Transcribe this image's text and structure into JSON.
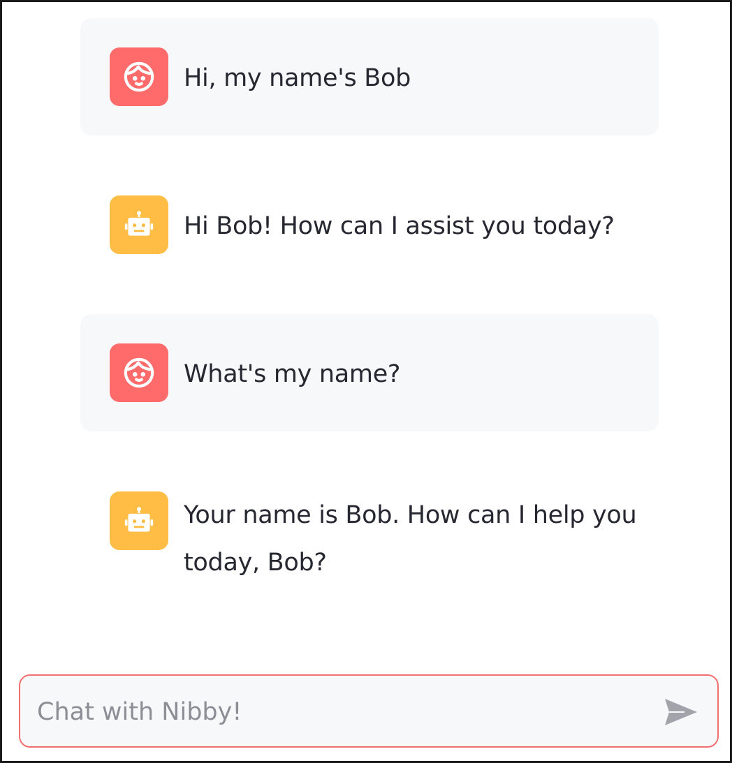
{
  "colors": {
    "user_avatar": "#ff6b6b",
    "assistant_avatar": "#ffbd45",
    "user_bubble": "#f7f8fa",
    "input_border": "#f36f6f",
    "text": "#262730"
  },
  "messages": [
    {
      "role": "user",
      "icon": "face-icon",
      "text": "Hi, my name's Bob"
    },
    {
      "role": "assistant",
      "icon": "robot-icon",
      "text": "Hi Bob! How can I assist you today?"
    },
    {
      "role": "user",
      "icon": "face-icon",
      "text": "What's my name?"
    },
    {
      "role": "assistant",
      "icon": "robot-icon",
      "text": "Your name is Bob. How can I help you today, Bob?"
    }
  ],
  "chat_input": {
    "placeholder": "Chat with Nibby!",
    "value": "",
    "send_icon": "send-icon"
  }
}
